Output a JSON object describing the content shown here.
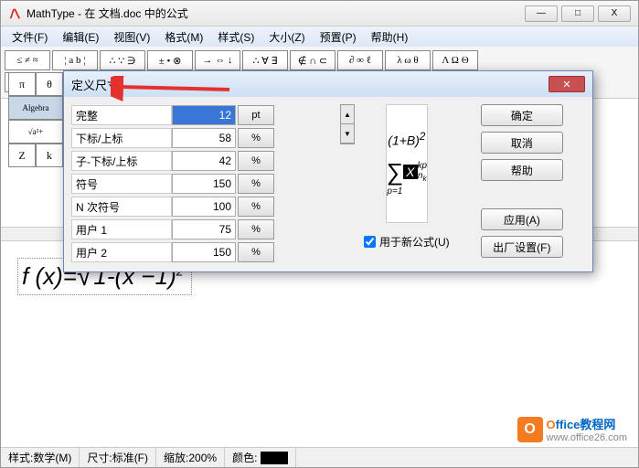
{
  "window": {
    "title": "MathType - 在 文档.doc 中的公式",
    "min": "—",
    "max": "□",
    "close": "X"
  },
  "menu": [
    "文件(F)",
    "编辑(E)",
    "视图(V)",
    "格式(M)",
    "样式(S)",
    "大小(Z)",
    "预置(P)",
    "帮助(H)"
  ],
  "toolbar_row1": [
    "≤ ≠ ≈",
    "¦ a b ¦",
    "∴ ∵ ∋",
    "± • ⊗",
    "→ ⇔ ↓",
    "∴ ∀ ∃",
    "∉ ∩ ⊂",
    "∂ ∞ ℓ",
    "λ ω θ",
    "Λ Ω Θ"
  ],
  "toolbar_row2_left": [
    "(□) [□]"
  ],
  "side_palette": [
    [
      "π",
      "θ"
    ],
    [
      "Algebra",
      ""
    ],
    [
      "√a²+",
      ""
    ],
    [
      "Z",
      "k"
    ]
  ],
  "dialog": {
    "title": "定义尺寸",
    "rows": [
      {
        "label": "完整",
        "value": "12",
        "unit": "pt"
      },
      {
        "label": "下标/上标",
        "value": "58",
        "unit": "%"
      },
      {
        "label": "子-下标/上标",
        "value": "42",
        "unit": "%"
      },
      {
        "label": "符号",
        "value": "150",
        "unit": "%"
      },
      {
        "label": "N 次符号",
        "value": "100",
        "unit": "%"
      },
      {
        "label": "用户 1",
        "value": "75",
        "unit": "%"
      },
      {
        "label": "用户 2",
        "value": "150",
        "unit": "%"
      }
    ],
    "checkbox": "用于新公式(U)",
    "buttons": {
      "ok": "确定",
      "cancel": "取消",
      "help": "帮助",
      "apply": "应用(A)",
      "factory": "出厂设置(F)"
    },
    "preview": {
      "top": "(1+B)",
      "top_sup": "2",
      "sum_upper": "kp",
      "sum_var": "X",
      "sum_sub": "n",
      "sum_sub2": "k",
      "sum_lower": "p=1"
    }
  },
  "formula": {
    "lhs": "f (x)=",
    "sqrt_content": "1-(x −1)",
    "sqrt_sup": "2"
  },
  "status": {
    "style_label": "样式: ",
    "style_value": "数学(M)",
    "size_label": "尺寸: ",
    "size_value": "标准(F)",
    "zoom_label": "缩放: ",
    "zoom_value": "200%",
    "color_label": "颜色:"
  },
  "watermark": {
    "brand_o": "O",
    "brand_rest": "ffice教程网",
    "url": "www.office26.com"
  }
}
